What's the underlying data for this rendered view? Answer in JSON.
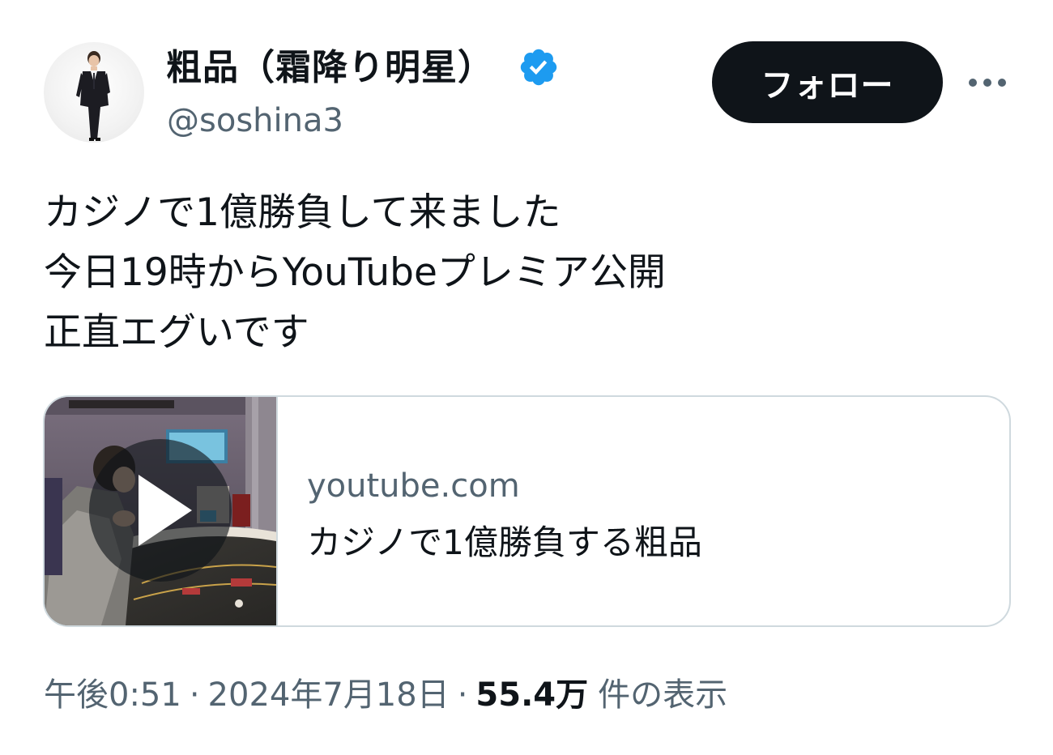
{
  "author": {
    "display_name": "粗品（霜降り明星）",
    "handle": "@soshina3",
    "verified_color": "#1d9bf0"
  },
  "actions": {
    "follow_label": "フォロー",
    "more_icon": "more-horizontal-icon"
  },
  "tweet": {
    "lines": [
      "カジノで1億勝負して来ました",
      "今日19時からYouTubeプレミア公開",
      "正直エグいです"
    ]
  },
  "card": {
    "domain": "youtube.com",
    "title": "カジノで1億勝負する粗品",
    "play_icon": "play-icon"
  },
  "meta": {
    "time": "午後0:51",
    "separator": "·",
    "date": "2024年7月18日",
    "views_count": "55.4万",
    "views_label": "件の表示"
  },
  "colors": {
    "text_primary": "#0f1419",
    "text_secondary": "#536471",
    "border": "#cfd9de",
    "follow_bg": "#0f1419",
    "verified": "#1d9bf0"
  }
}
